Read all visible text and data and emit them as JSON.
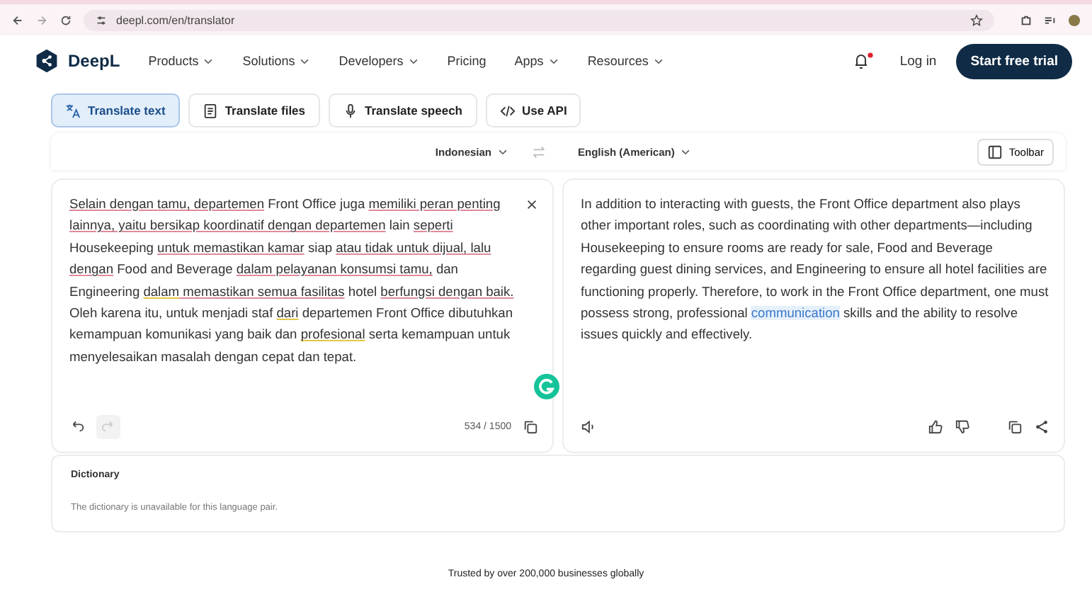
{
  "browser": {
    "url": "deepl.com/en/translator"
  },
  "nav": {
    "brand": "DeepL",
    "items": [
      {
        "label": "Products",
        "has_menu": true
      },
      {
        "label": "Solutions",
        "has_menu": true
      },
      {
        "label": "Developers",
        "has_menu": true
      },
      {
        "label": "Pricing",
        "has_menu": false
      },
      {
        "label": "Apps",
        "has_menu": true
      },
      {
        "label": "Resources",
        "has_menu": true
      }
    ],
    "login": "Log in",
    "cta": "Start free trial",
    "notification": true
  },
  "tabs": [
    {
      "label": "Translate text",
      "selected": true
    },
    {
      "label": "Translate files",
      "selected": false
    },
    {
      "label": "Translate speech",
      "selected": false
    },
    {
      "label": "Use API",
      "selected": false
    }
  ],
  "languages": {
    "source": "Indonesian",
    "target": "English (American)",
    "toolbar": "Toolbar"
  },
  "source": {
    "segments": [
      {
        "text": "Selain dengan tamu, departemen",
        "kind": "spelling"
      },
      {
        "text": " Front Office juga ",
        "kind": "plain"
      },
      {
        "text": "memiliki peran penting lainnya, yaitu bersikap koordinatif dengan departemen",
        "kind": "spelling"
      },
      {
        "text": " lain ",
        "kind": "plain"
      },
      {
        "text": "seperti",
        "kind": "spelling"
      },
      {
        "text": " Housekeeping ",
        "kind": "plain"
      },
      {
        "text": "untuk memastikan kamar",
        "kind": "spelling"
      },
      {
        "text": " siap ",
        "kind": "plain"
      },
      {
        "text": "atau tidak untuk dijual, lalu dengan",
        "kind": "spelling"
      },
      {
        "text": " Food and Beverage ",
        "kind": "plain"
      },
      {
        "text": "dalam pelayanan konsumsi tamu,",
        "kind": "spelling"
      },
      {
        "text": " dan Engineering ",
        "kind": "plain"
      },
      {
        "text": "dalam",
        "kind": "grammar"
      },
      {
        "text": " memastikan semua fasilitas",
        "kind": "spelling"
      },
      {
        "text": " hotel ",
        "kind": "plain"
      },
      {
        "text": "berfungsi dengan baik.",
        "kind": "spelling"
      },
      {
        "text": " Oleh karena itu, untuk menjadi staf ",
        "kind": "plain"
      },
      {
        "text": "dari",
        "kind": "grammar"
      },
      {
        "text": " departemen Front Office dibutuhkan kemampuan komunikasi yang baik dan ",
        "kind": "plain"
      },
      {
        "text": "profesional",
        "kind": "grammar"
      },
      {
        "text": " serta kemampuan untuk menyelesaikan masalah dengan cepat dan tepat.",
        "kind": "plain"
      }
    ],
    "count": "534 / 1500"
  },
  "target": {
    "segments": [
      {
        "text": "In addition to interacting with guests, the Front Office department also plays other important roles, such as coordinating with other departments—including Housekeeping to ensure rooms are ready for sale, Food and Beverage regarding guest dining services, and Engineering to ensure all hotel facilities are functioning properly. Therefore, to work in the Front Office department, one must possess strong, professional ",
        "kind": "plain"
      },
      {
        "text": "communication",
        "kind": "highlight"
      },
      {
        "text": " skills and the ability to resolve issues quickly and effectively.",
        "kind": "plain"
      }
    ]
  },
  "dictionary": {
    "title": "Dictionary",
    "message": "The dictionary is unavailable for this language pair."
  },
  "footer": "Trusted by over 200,000 businesses globally"
}
